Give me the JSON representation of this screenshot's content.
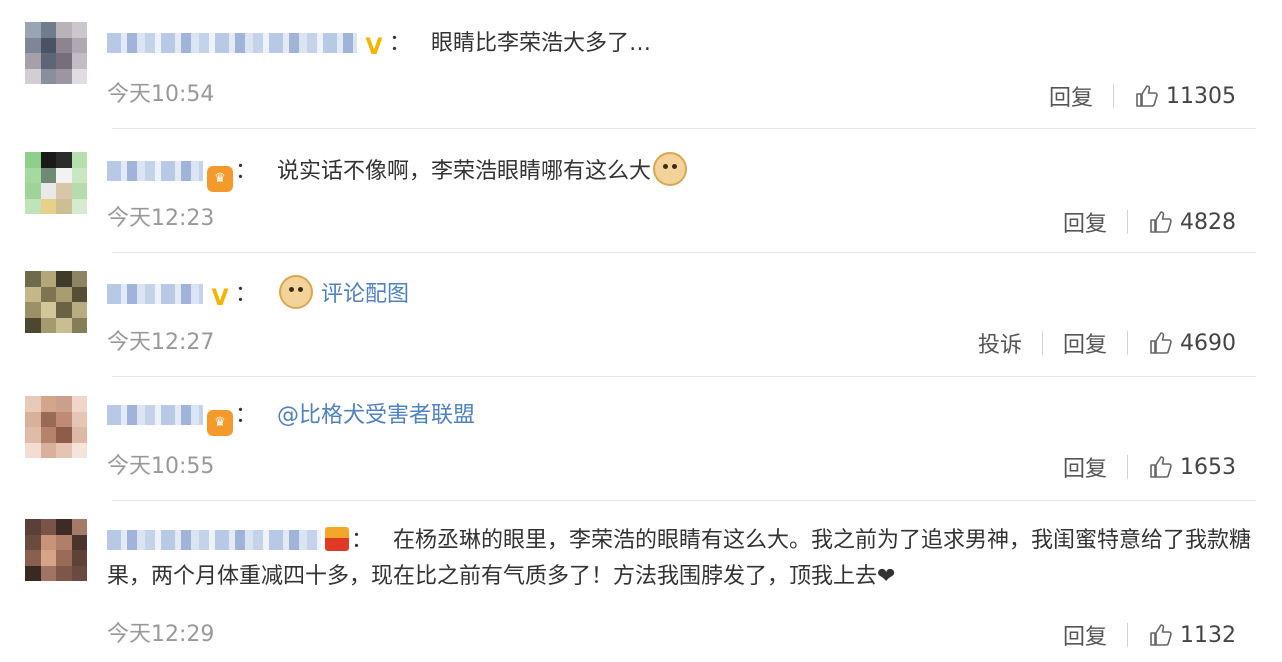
{
  "comments": [
    {
      "badge": "V",
      "colon": "：",
      "text": "眼睛比李荣浩大多了…",
      "timestamp": "今天10:54",
      "reply_label": "回复",
      "likes": "11305"
    },
    {
      "badge": "皇冠",
      "colon": "：",
      "text": "说实话不像啊，李荣浩眼睛哪有这么大",
      "timestamp": "今天12:23",
      "reply_label": "回复",
      "likes": "4828"
    },
    {
      "badge": "V",
      "colon": "：",
      "image_link": "评论配图",
      "timestamp": "今天12:27",
      "report_label": "投诉",
      "reply_label": "回复",
      "likes": "4690"
    },
    {
      "badge": "皇冠",
      "colon": "：",
      "mention": "@比格犬受害者联盟",
      "timestamp": "今天10:55",
      "reply_label": "回复",
      "likes": "1653"
    },
    {
      "colon": "：",
      "text": "在杨丞琳的眼里，李荣浩的眼睛有这么大。我之前为了追求男神，我闺蜜特意给了我款糖果，两个月体重减四十多，现在比之前有气质多了！方法我围脖发了，顶我上去",
      "heart": "❤",
      "timestamp": "今天12:29",
      "reply_label": "回复",
      "likes": "1132"
    }
  ],
  "colors": {
    "link": "#4f82c2",
    "timestamp": "#999999",
    "text": "#333333",
    "divider": "#e6e6e6",
    "v_badge": "#f4b400"
  }
}
